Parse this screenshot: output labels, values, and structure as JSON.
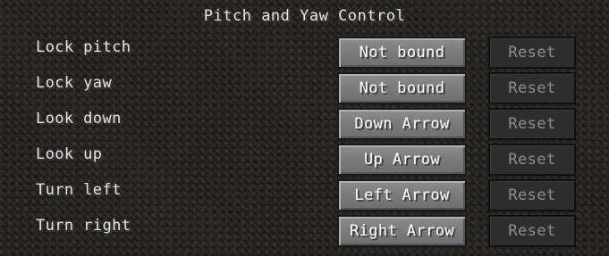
{
  "screen": {
    "title": "Pitch and Yaw Control"
  },
  "bindings": [
    {
      "action": "Lock pitch",
      "key": "Not bound",
      "reset": "Reset"
    },
    {
      "action": "Lock yaw",
      "key": "Not bound",
      "reset": "Reset"
    },
    {
      "action": "Look down",
      "key": "Down Arrow",
      "reset": "Reset"
    },
    {
      "action": "Look up",
      "key": "Up Arrow",
      "reset": "Reset"
    },
    {
      "action": "Turn left",
      "key": "Left Arrow",
      "reset": "Reset"
    },
    {
      "action": "Turn right",
      "key": "Right Arrow",
      "reset": "Reset"
    }
  ]
}
